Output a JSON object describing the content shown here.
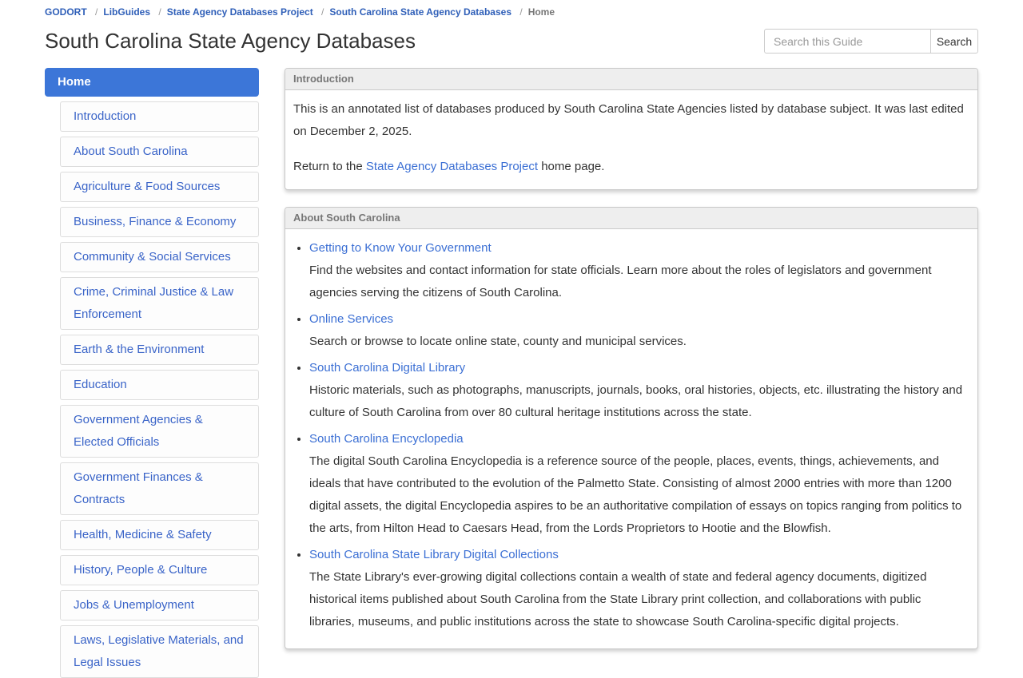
{
  "breadcrumb": {
    "separator": "/",
    "items": [
      "GODORT",
      "LibGuides",
      "State Agency Databases Project",
      "South Carolina State Agency Databases",
      "Home"
    ]
  },
  "page_title": "South Carolina State Agency Databases",
  "search": {
    "placeholder": "Search this Guide",
    "button_label": "Search"
  },
  "sidebar": {
    "home_label": "Home",
    "items": [
      "Introduction",
      "About South Carolina",
      "Agriculture & Food Sources",
      "Business, Finance & Economy",
      "Community & Social Services",
      "Crime, Criminal Justice & Law Enforcement",
      "Earth & the Environment",
      "Education",
      "Government Agencies & Elected Officials",
      "Government Finances & Contracts",
      "Health, Medicine & Safety",
      "History, People & Culture",
      "Jobs & Unemployment",
      "Laws, Legislative Materials, and Legal Issues"
    ]
  },
  "panels": {
    "introduction": {
      "title": "Introduction",
      "paragraph1": "This is an annotated list of databases produced by South Carolina State Agencies listed by database subject. It was last edited on December 2, 2025.",
      "paragraph2_prefix": "Return to the ",
      "paragraph2_link": "State Agency Databases Project",
      "paragraph2_suffix": " home page."
    },
    "about": {
      "title": "About South Carolina",
      "links": [
        {
          "label": "Getting to Know Your Government",
          "description": "Find the websites and contact information for state officials. Learn more about the roles of legislators and government agencies serving the citizens of South Carolina."
        },
        {
          "label": "Online Services",
          "description": "Search or browse to locate online state, county and municipal services."
        },
        {
          "label": "South Carolina Digital Library",
          "description": "Historic materials, such as photographs, manuscripts, journals, books, oral histories, objects, etc. illustrating the history and culture of South Carolina from over 80 cultural heritage institutions across the state."
        },
        {
          "label": "South Carolina Encyclopedia",
          "description": "The digital South Carolina Encyclopedia is a reference source of the people, places, events, things, achievements, and ideals that have contributed to the evolution of the Palmetto State. Consisting of almost 2000 entries with more than 1200 digital assets, the digital Encyclopedia aspires to be an authoritative compilation of essays on topics ranging from politics to the arts, from Hilton Head to Caesars Head, from the Lords Proprietors to Hootie and the Blowfish."
        },
        {
          "label": "South Carolina State Library Digital Collections",
          "description": "The State Library's ever-growing digital collections contain a wealth of state and federal agency documents, digitized historical items published about South Carolina from the State Library print collection, and collaborations with public libraries, museums, and public institutions across the state to showcase South Carolina-specific digital projects."
        }
      ]
    }
  },
  "colors": {
    "active_nav_bg": "#3c76d8",
    "link_blue": "#3b6fd4",
    "panel_header_bg": "#eeeeee",
    "panel_header_text": "#777777",
    "body_text": "#333333"
  }
}
